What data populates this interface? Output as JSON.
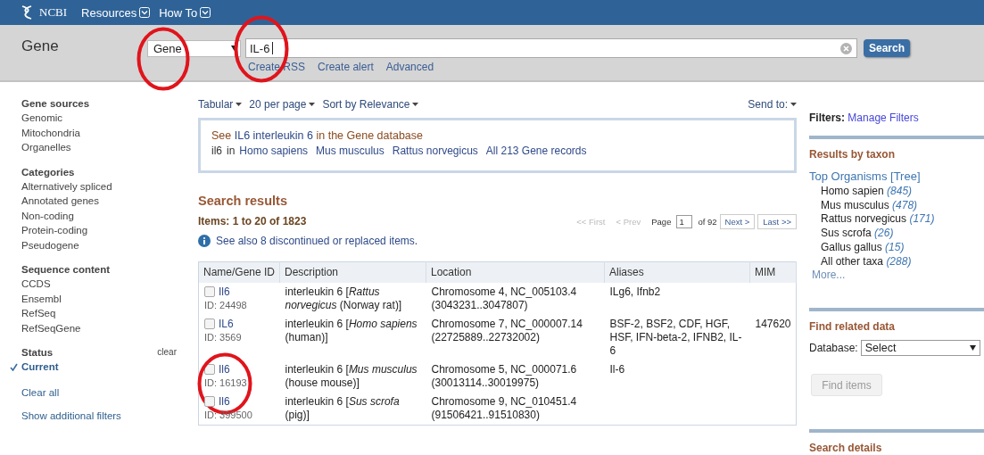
{
  "header": {
    "logo": "NCBI",
    "menus": [
      "Resources",
      "How To"
    ]
  },
  "search": {
    "title": "Gene",
    "database": {
      "value": "Gene",
      "circled": true
    },
    "query": {
      "value": "IL-6",
      "circled": true
    },
    "button": "Search",
    "links": [
      "Create RSS",
      "Create alert",
      "Advanced"
    ]
  },
  "sidebar": {
    "groups": [
      {
        "title": "Gene sources",
        "items": [
          {
            "label": "Genomic",
            "checked": false
          },
          {
            "label": "Mitochondria",
            "checked": false
          },
          {
            "label": "Organelles",
            "checked": false
          }
        ]
      },
      {
        "title": "Categories",
        "items": [
          {
            "label": "Alternatively spliced",
            "checked": false
          },
          {
            "label": "Annotated genes",
            "checked": false
          },
          {
            "label": "Non-coding",
            "checked": false
          },
          {
            "label": "Protein-coding",
            "checked": false
          },
          {
            "label": "Pseudogene",
            "checked": false
          }
        ]
      },
      {
        "title": "Sequence content",
        "items": [
          {
            "label": "CCDS",
            "checked": false
          },
          {
            "label": "Ensembl",
            "checked": false
          },
          {
            "label": "RefSeq",
            "checked": false
          },
          {
            "label": "RefSeqGene",
            "checked": false
          }
        ]
      },
      {
        "title": "Status",
        "clear": "clear",
        "items": [
          {
            "label": "Current",
            "checked": true
          }
        ]
      }
    ],
    "links": [
      "Clear all",
      "Show additional filters"
    ]
  },
  "toolbar": {
    "menus": [
      "Tabular",
      "20 per page",
      "Sort by Relevance"
    ],
    "send_to": "Send to:"
  },
  "suggestion": {
    "prefix": "See",
    "link": "IL6 interleukin 6",
    "suffix": "in the Gene database",
    "term": "il6",
    "in": "in",
    "organisms": [
      "Homo sapiens",
      "Mus musculus",
      "Rattus norvegicus",
      "All 213 Gene records"
    ]
  },
  "results": {
    "title": "Search results",
    "items": "Items: 1 to 20 of 1823",
    "pager": {
      "first": "<< First",
      "prev": "< Prev",
      "page_label": "Page",
      "page": "1",
      "of": "of 92",
      "next": "Next >",
      "last": "Last >>"
    },
    "see_also": "See also 8 discontinued or replaced items."
  },
  "table": {
    "columns": [
      "Name/Gene ID",
      "Description",
      "Location",
      "Aliases",
      "MIM"
    ],
    "rows": [
      {
        "name": "Il6",
        "id": "ID: 24498",
        "description": "interleukin 6 [*Rattus norvegicus* (Norway rat)]",
        "location": "Chromosome 4, NC_005103.4 (3043231..3047807)",
        "aliases": "ILg6, Ifnb2",
        "mim": "",
        "checked": false,
        "circled": false
      },
      {
        "name": "IL6",
        "id": "ID: 3569",
        "description": "interleukin 6 [*Homo sapiens* (human)]",
        "location": "Chromosome 7, NC_000007.14 (22725889..22732002)",
        "aliases": "BSF-2, BSF2, CDF, HGF, HSF, IFN-beta-2, IFNB2, IL-6",
        "mim": "147620",
        "checked": false,
        "circled": false
      },
      {
        "name": "Il6",
        "id": "ID: 16193",
        "description": "interleukin 6 [*Mus musculus* (house mouse)]",
        "location": "Chromosome 5, NC_000071.6 (30013114..30019975)",
        "aliases": "Il-6",
        "mim": "",
        "checked": false,
        "circled": true
      },
      {
        "name": "Il6",
        "id": "ID: 399500",
        "description": "interleukin 6 [*Sus scrofa* (pig)]",
        "location": "Chromosome 9, NC_010451.4 (91506421..91510830)",
        "aliases": "",
        "mim": "",
        "checked": false,
        "circled": false
      }
    ]
  },
  "right": {
    "filters_label": "Filters:",
    "manage": "Manage Filters",
    "taxon_title": "Results by taxon",
    "top": "Top Organisms",
    "tree": "[Tree]",
    "taxa": [
      {
        "name": "Homo sapien",
        "count": "(845)"
      },
      {
        "name": "Mus musculus",
        "count": "(478)"
      },
      {
        "name": "Rattus norvegicus",
        "count": "(171)"
      },
      {
        "name": "Sus scrofa",
        "count": "(26)"
      },
      {
        "name": "Gallus gallus",
        "count": "(15)"
      },
      {
        "name": "All other taxa",
        "count": "(288)"
      }
    ],
    "more": "More...",
    "related_title": "Find related data",
    "database_label": "Database:",
    "database_value": "Select",
    "find_button": {
      "label": "Find items",
      "disabled": true
    },
    "details_title": "Search details"
  }
}
